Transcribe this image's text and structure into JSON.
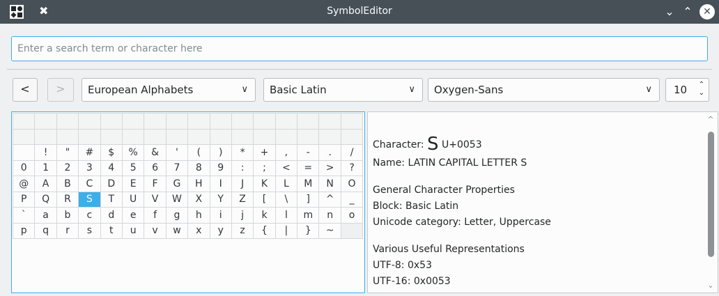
{
  "window": {
    "title": "SymbolEditor",
    "pin_glyph": "✖",
    "minimize_glyph": "⌄",
    "maximize_glyph": "⌃",
    "close_glyph": "✕"
  },
  "search": {
    "placeholder": "Enter a search term or character here",
    "value": ""
  },
  "toolbar": {
    "back_glyph": "<",
    "forward_glyph": ">",
    "section": "European Alphabets",
    "block": "Basic Latin",
    "font": "Oxygen-Sans",
    "font_size": "10",
    "dropdown_glyph": "∨",
    "spin_up": "⌃",
    "spin_down": "⌄"
  },
  "grid": {
    "selected": "S",
    "rows": [
      [
        "",
        "",
        "",
        "",
        "",
        "",
        "",
        "",
        "",
        "",
        "",
        "",
        "",
        "",
        "",
        ""
      ],
      [
        "",
        "",
        "",
        "",
        "",
        "",
        "",
        "",
        "",
        "",
        "",
        "",
        "",
        "",
        "",
        ""
      ],
      [
        "",
        "!",
        "\"",
        "#",
        "$",
        "%",
        "&",
        "'",
        "(",
        ")",
        "*",
        "+",
        ",",
        "-",
        ".",
        "/"
      ],
      [
        "0",
        "1",
        "2",
        "3",
        "4",
        "5",
        "6",
        "7",
        "8",
        "9",
        ":",
        ";",
        "<",
        "=",
        ">",
        "?"
      ],
      [
        "@",
        "A",
        "B",
        "C",
        "D",
        "E",
        "F",
        "G",
        "H",
        "I",
        "J",
        "K",
        "L",
        "M",
        "N",
        "O"
      ],
      [
        "P",
        "Q",
        "R",
        "S",
        "T",
        "U",
        "V",
        "W",
        "X",
        "Y",
        "Z",
        "[",
        "\\",
        "]",
        "^",
        "_"
      ],
      [
        "`",
        "a",
        "b",
        "c",
        "d",
        "e",
        "f",
        "g",
        "h",
        "i",
        "j",
        "k",
        "l",
        "m",
        "n",
        "o"
      ],
      [
        "p",
        "q",
        "r",
        "s",
        "t",
        "u",
        "v",
        "w",
        "x",
        "y",
        "z",
        "{",
        "|",
        "}",
        "~",
        ""
      ]
    ]
  },
  "info": {
    "character_label": "Character:",
    "character": "S",
    "codepoint": "U+0053",
    "name": "Name: LATIN CAPITAL LETTER S",
    "general_heading": "General Character Properties",
    "block": "Block: Basic Latin",
    "category": "Unicode category: Letter, Uppercase",
    "useful_heading": "Various Useful Representations",
    "utf8": "UTF-8: 0x53",
    "utf16": "UTF-16: 0x0053",
    "scroll_up": "^",
    "scroll_down": "⌄"
  },
  "colors": {
    "accent": "#3daee9",
    "titlebar": "#475057",
    "window_bg": "#eff0f1"
  }
}
